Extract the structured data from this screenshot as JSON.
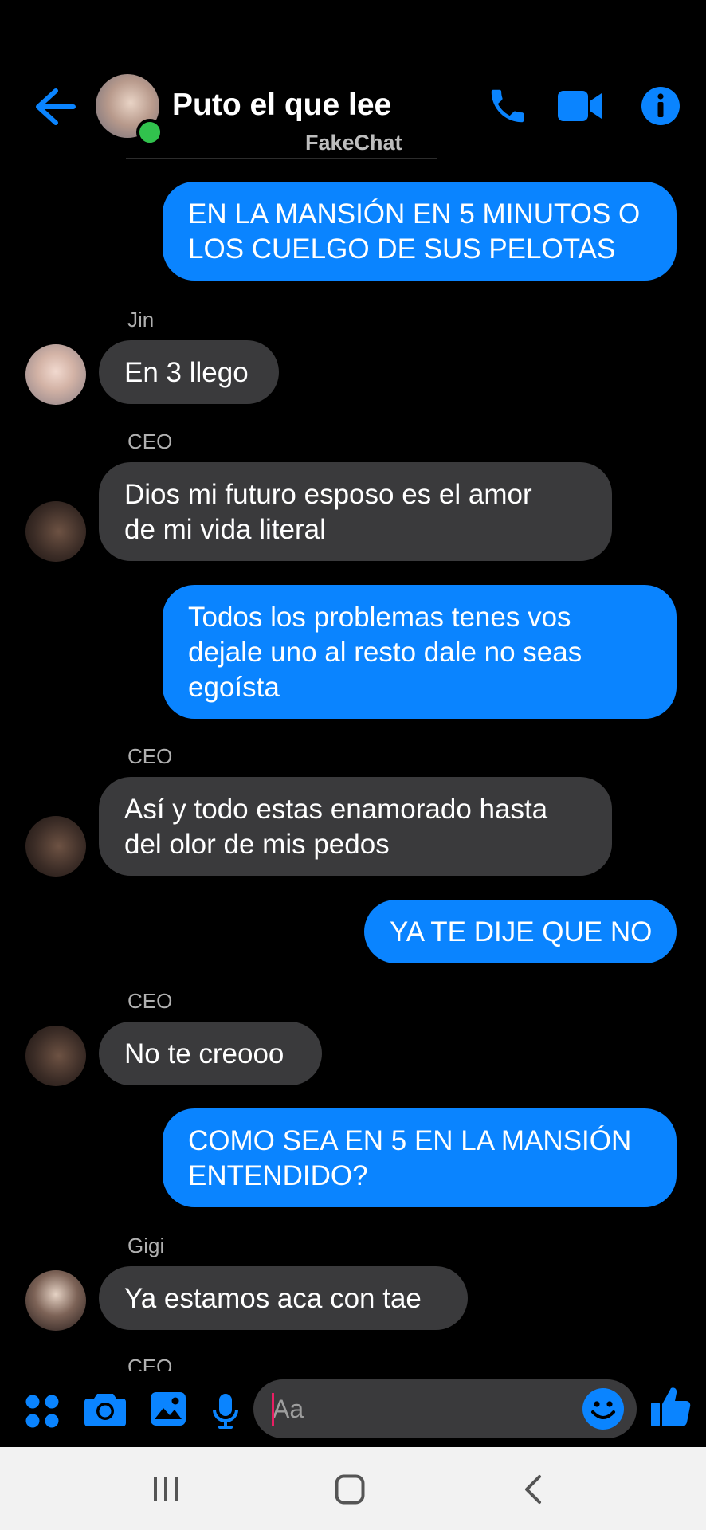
{
  "header": {
    "back_icon": "arrow-left-icon",
    "title": "Puto el que lee",
    "watermark": "FakeChat",
    "call_icon": "phone-icon",
    "video_icon": "video-camera-icon",
    "info_icon": "info-icon",
    "accent_color": "#0a84ff",
    "online_color": "#31c24d"
  },
  "messages": [
    {
      "direction": "out",
      "lines": [
        "EN LA MANSIÓN EN 5 MINUTOS O",
        "LOS CUELGO DE SUS PELOTAS"
      ]
    },
    {
      "direction": "in",
      "sender": "Jin",
      "lines": [
        "En 3 llego"
      ]
    },
    {
      "direction": "in",
      "sender": "CEO",
      "lines": [
        "Dios mi futuro esposo es el amor",
        "de mi vida literal"
      ]
    },
    {
      "direction": "out",
      "lines": [
        "Todos los problemas tenes vos",
        "dejale uno al resto dale no seas",
        "egoísta"
      ]
    },
    {
      "direction": "in",
      "sender": "CEO",
      "lines": [
        "Así y todo estas enamorado hasta",
        "del olor de mis pedos"
      ]
    },
    {
      "direction": "out",
      "lines": [
        "YA TE DIJE QUE NO"
      ]
    },
    {
      "direction": "in",
      "sender": "CEO",
      "lines": [
        "No te creooo"
      ]
    },
    {
      "direction": "out",
      "lines": [
        "COMO SEA EN 5 EN LA MANSIÓN",
        "ENTENDIDO?"
      ]
    },
    {
      "direction": "in",
      "sender": "Gigi",
      "lines": [
        "Ya estamos aca con tae"
      ]
    },
    {
      "direction": "in",
      "sender": "CEO",
      "partial": true
    }
  ],
  "composer": {
    "apps_icon": "apps-grid-icon",
    "camera_icon": "camera-icon",
    "gallery_icon": "image-icon",
    "mic_icon": "microphone-icon",
    "placeholder": "Aa",
    "emoji_icon": "emoji-icon",
    "like_icon": "thumbs-up-icon"
  },
  "system_nav": {
    "recents_icon": "recent-apps-icon",
    "home_icon": "home-icon",
    "back_icon": "back-chevron-icon"
  }
}
